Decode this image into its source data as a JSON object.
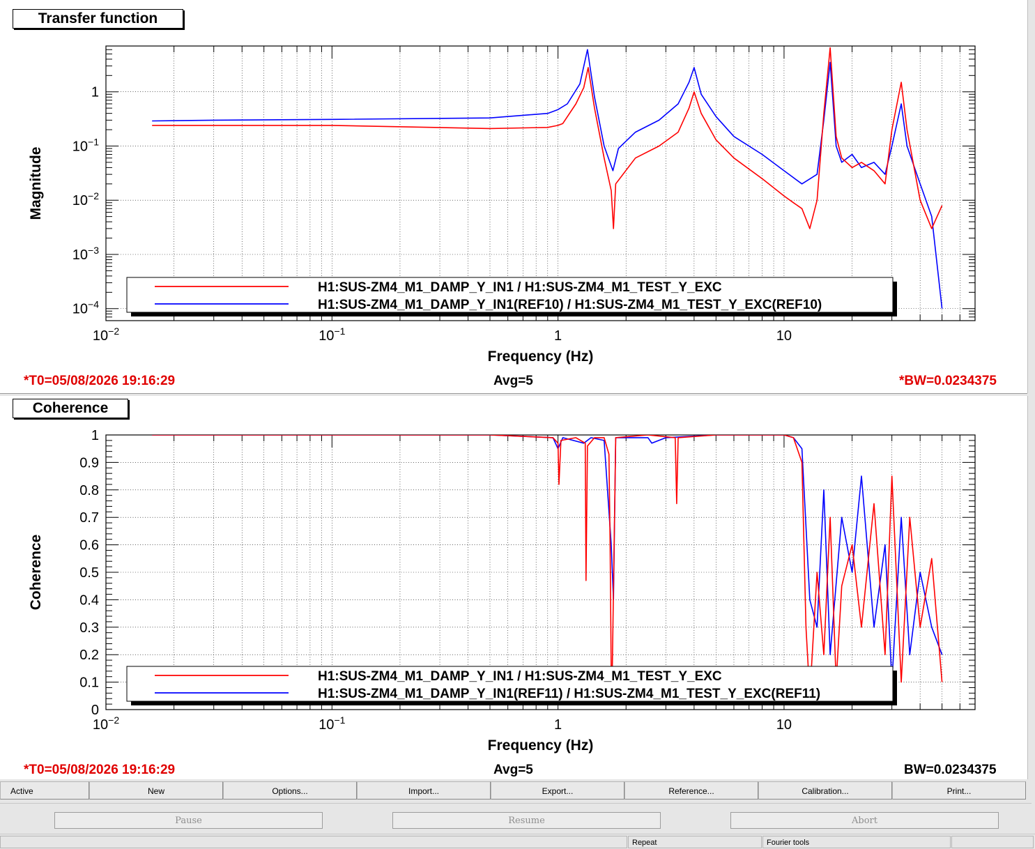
{
  "panels": {
    "tf_title": "Transfer function",
    "coh_title": "Coherence"
  },
  "status": {
    "top_t0": "*T0=05/08/2026 19:16:29",
    "top_avg": "Avg=5",
    "top_bw": "*BW=0.0234375",
    "bottom_t0": "*T0=05/08/2026 19:16:29",
    "bottom_avg": "Avg=5",
    "bottom_bw": "BW=0.0234375"
  },
  "toolbar": {
    "active": "Active",
    "new": "New",
    "options": "Options...",
    "import": "Import...",
    "export": "Export...",
    "reference": "Reference...",
    "calibration": "Calibration...",
    "print": "Print..."
  },
  "controls": {
    "pause": "Pause",
    "resume": "Resume",
    "abort": "Abort"
  },
  "statusbar": {
    "repeat": "Repeat",
    "fourier": "Fourier tools"
  },
  "colors": {
    "series_current": "#ff0000",
    "series_reference": "#0000ff",
    "status_red": "#e00000"
  },
  "chart_data": [
    {
      "type": "line",
      "title": "Transfer function",
      "xlabel": "Frequency (Hz)",
      "ylabel": "Magnitude",
      "xscale": "log",
      "yscale": "log",
      "xlim": [
        0.01,
        70
      ],
      "ylim": [
        6e-05,
        7
      ],
      "xticks": [
        {
          "v": 0.01,
          "b": "10",
          "e": "−2"
        },
        {
          "v": 0.1,
          "b": "10",
          "e": "−1"
        },
        {
          "v": 1,
          "b": "1",
          "e": ""
        },
        {
          "v": 10,
          "b": "10",
          "e": ""
        }
      ],
      "yticks": [
        {
          "v": 0.0001,
          "b": "10",
          "e": "−4"
        },
        {
          "v": 0.001,
          "b": "10",
          "e": "−3"
        },
        {
          "v": 0.01,
          "b": "10",
          "e": "−2"
        },
        {
          "v": 0.1,
          "b": "10",
          "e": "−1"
        },
        {
          "v": 1,
          "b": "1",
          "e": ""
        }
      ],
      "grid": true,
      "legend_position": "bottom",
      "series": [
        {
          "name": "H1:SUS-ZM4_M1_DAMP_Y_IN1 / H1:SUS-ZM4_M1_TEST_Y_EXC",
          "color": "#ff0000",
          "x": [
            0.016,
            0.03,
            0.1,
            0.5,
            0.9,
            1.0,
            1.05,
            1.2,
            1.3,
            1.36,
            1.45,
            1.6,
            1.72,
            1.76,
            1.8,
            2.2,
            2.8,
            3.4,
            3.8,
            4.0,
            4.3,
            5,
            6,
            8,
            10,
            11,
            12,
            13,
            14,
            15,
            16,
            17,
            18,
            20,
            22,
            25,
            28,
            30,
            33,
            35,
            40,
            45,
            50
          ],
          "y": [
            0.24,
            0.24,
            0.24,
            0.21,
            0.22,
            0.24,
            0.26,
            0.6,
            1.2,
            2.8,
            0.5,
            0.06,
            0.015,
            0.003,
            0.02,
            0.06,
            0.1,
            0.18,
            0.5,
            1.0,
            0.4,
            0.13,
            0.06,
            0.025,
            0.012,
            0.009,
            0.007,
            0.003,
            0.01,
            0.4,
            6.5,
            0.15,
            0.06,
            0.04,
            0.05,
            0.035,
            0.02,
            0.2,
            1.5,
            0.2,
            0.01,
            0.003,
            0.008
          ]
        },
        {
          "name": "H1:SUS-ZM4_M1_DAMP_Y_IN1(REF10) / H1:SUS-ZM4_M1_TEST_Y_EXC(REF10)",
          "color": "#0000ff",
          "x": [
            0.016,
            0.03,
            0.1,
            0.5,
            0.9,
            1.0,
            1.1,
            1.25,
            1.35,
            1.45,
            1.6,
            1.75,
            1.85,
            2.2,
            2.8,
            3.4,
            3.8,
            4.0,
            4.3,
            5,
            6,
            8,
            10,
            12,
            14,
            15,
            16,
            17,
            18,
            20,
            22,
            25,
            28,
            30,
            33,
            35,
            40,
            45,
            50
          ],
          "y": [
            0.29,
            0.3,
            0.31,
            0.33,
            0.4,
            0.47,
            0.6,
            1.4,
            6.0,
            0.8,
            0.1,
            0.035,
            0.09,
            0.18,
            0.3,
            0.6,
            1.5,
            2.8,
            0.9,
            0.35,
            0.15,
            0.07,
            0.035,
            0.02,
            0.03,
            0.3,
            3.5,
            0.1,
            0.05,
            0.07,
            0.04,
            0.05,
            0.03,
            0.1,
            0.6,
            0.1,
            0.02,
            0.005,
            0.0001
          ]
        }
      ]
    },
    {
      "type": "line",
      "title": "Coherence",
      "xlabel": "Frequency (Hz)",
      "ylabel": "Coherence",
      "xscale": "log",
      "yscale": "linear",
      "xlim": [
        0.01,
        70
      ],
      "ylim": [
        0,
        1
      ],
      "xticks": [
        {
          "v": 0.01,
          "b": "10",
          "e": "−2"
        },
        {
          "v": 0.1,
          "b": "10",
          "e": "−1"
        },
        {
          "v": 1,
          "b": "1",
          "e": ""
        },
        {
          "v": 10,
          "b": "10",
          "e": ""
        }
      ],
      "yticks": [
        {
          "v": 0,
          "b": "0",
          "e": ""
        },
        {
          "v": 0.1,
          "b": "0.1",
          "e": ""
        },
        {
          "v": 0.2,
          "b": "0.2",
          "e": ""
        },
        {
          "v": 0.3,
          "b": "0.3",
          "e": ""
        },
        {
          "v": 0.4,
          "b": "0.4",
          "e": ""
        },
        {
          "v": 0.5,
          "b": "0.5",
          "e": ""
        },
        {
          "v": 0.6,
          "b": "0.6",
          "e": ""
        },
        {
          "v": 0.7,
          "b": "0.7",
          "e": ""
        },
        {
          "v": 0.8,
          "b": "0.8",
          "e": ""
        },
        {
          "v": 0.9,
          "b": "0.9",
          "e": ""
        },
        {
          "v": 1,
          "b": "1",
          "e": ""
        }
      ],
      "grid": true,
      "legend_position": "bottom",
      "series": [
        {
          "name": "H1:SUS-ZM4_M1_DAMP_Y_IN1 / H1:SUS-ZM4_M1_TEST_Y_EXC",
          "color": "#ff0000",
          "x": [
            0.016,
            0.5,
            0.95,
            1.0,
            1.01,
            1.03,
            1.2,
            1.32,
            1.33,
            1.35,
            1.45,
            1.6,
            1.68,
            1.7,
            1.72,
            1.74,
            1.8,
            2.5,
            3.3,
            3.35,
            3.4,
            5,
            8,
            10,
            11,
            12,
            12.5,
            13,
            14,
            15,
            16,
            17,
            18,
            20,
            22,
            25,
            28,
            30,
            33,
            36,
            40,
            45,
            50
          ],
          "y": [
            1,
            1,
            0.99,
            0.97,
            0.82,
            0.98,
            0.99,
            0.97,
            0.47,
            0.96,
            0.99,
            0.99,
            0.93,
            0.6,
            0.12,
            0.16,
            0.99,
            1,
            0.99,
            0.75,
            0.99,
            1,
            1,
            1,
            0.99,
            0.9,
            0.3,
            0.05,
            0.5,
            0.2,
            0.7,
            0.1,
            0.45,
            0.6,
            0.3,
            0.75,
            0.2,
            0.85,
            0.1,
            0.7,
            0.3,
            0.55,
            0.1
          ]
        },
        {
          "name": "H1:SUS-ZM4_M1_DAMP_Y_IN1(REF11) / H1:SUS-ZM4_M1_TEST_Y_EXC(REF11)",
          "color": "#0000ff",
          "x": [
            0.016,
            0.5,
            0.95,
            1.0,
            1.05,
            1.3,
            1.4,
            1.6,
            1.72,
            1.76,
            1.8,
            2.5,
            2.6,
            3.0,
            5,
            8,
            10,
            11,
            12,
            13,
            14,
            15,
            16,
            18,
            20,
            22,
            25,
            28,
            30,
            33,
            36,
            40,
            45,
            50
          ],
          "y": [
            1,
            1,
            0.99,
            0.95,
            0.99,
            0.97,
            0.99,
            0.98,
            0.6,
            0.4,
            0.99,
            0.99,
            0.97,
            0.99,
            1,
            1,
            1,
            0.99,
            0.95,
            0.4,
            0.3,
            0.8,
            0.2,
            0.7,
            0.5,
            0.85,
            0.3,
            0.6,
            0.1,
            0.7,
            0.2,
            0.5,
            0.3,
            0.2
          ]
        }
      ]
    }
  ]
}
